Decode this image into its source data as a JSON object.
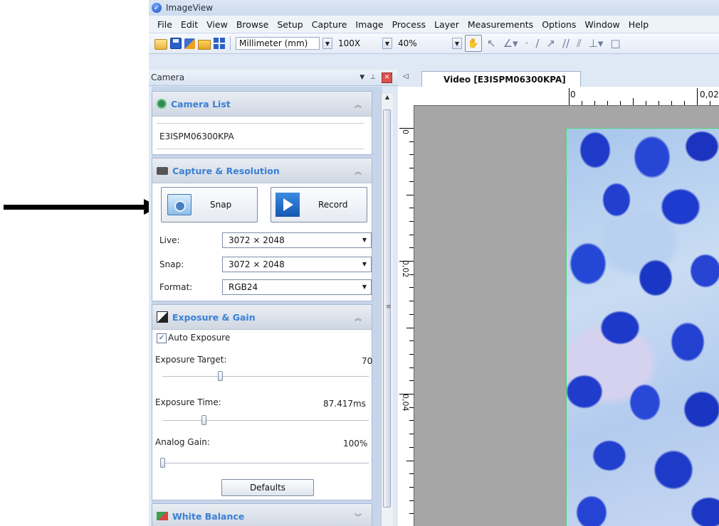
{
  "window": {
    "title": "ImageView"
  },
  "menu": [
    "File",
    "Edit",
    "View",
    "Browse",
    "Setup",
    "Capture",
    "Image",
    "Process",
    "Layer",
    "Measurements",
    "Options",
    "Window",
    "Help"
  ],
  "toolbar": {
    "unit": "Millimeter (mm)",
    "magnification": "100X",
    "zoom": "40%"
  },
  "panel": {
    "title": "Camera"
  },
  "camera_list": {
    "title": "Camera List",
    "device": "E3ISPM06300KPA"
  },
  "capture": {
    "title": "Capture & Resolution",
    "snap_label": "Snap",
    "record_label": "Record",
    "live_label": "Live:",
    "live_value": "3072 × 2048",
    "snap_res_label": "Snap:",
    "snap_value": "3072 × 2048",
    "format_label": "Format:",
    "format_value": "RGB24"
  },
  "exposure": {
    "title": "Exposure & Gain",
    "auto_label": "Auto Exposure",
    "auto_checked": true,
    "target_label": "Exposure Target:",
    "target_value": "70",
    "target_level": 0.28,
    "time_label": "Exposure Time:",
    "time_value": "87.417ms",
    "time_level": 0.2,
    "gain_label": "Analog Gain:",
    "gain_value": "100%",
    "gain_level": 0.0,
    "defaults_label": "Defaults"
  },
  "white_balance": {
    "title": "White Balance"
  },
  "document": {
    "tab": "Video [E3ISPM06300KPA]"
  },
  "ruler": {
    "top_labels": [
      "0",
      "0,02"
    ],
    "left_labels": [
      "0",
      "0,02",
      "0,04"
    ]
  }
}
